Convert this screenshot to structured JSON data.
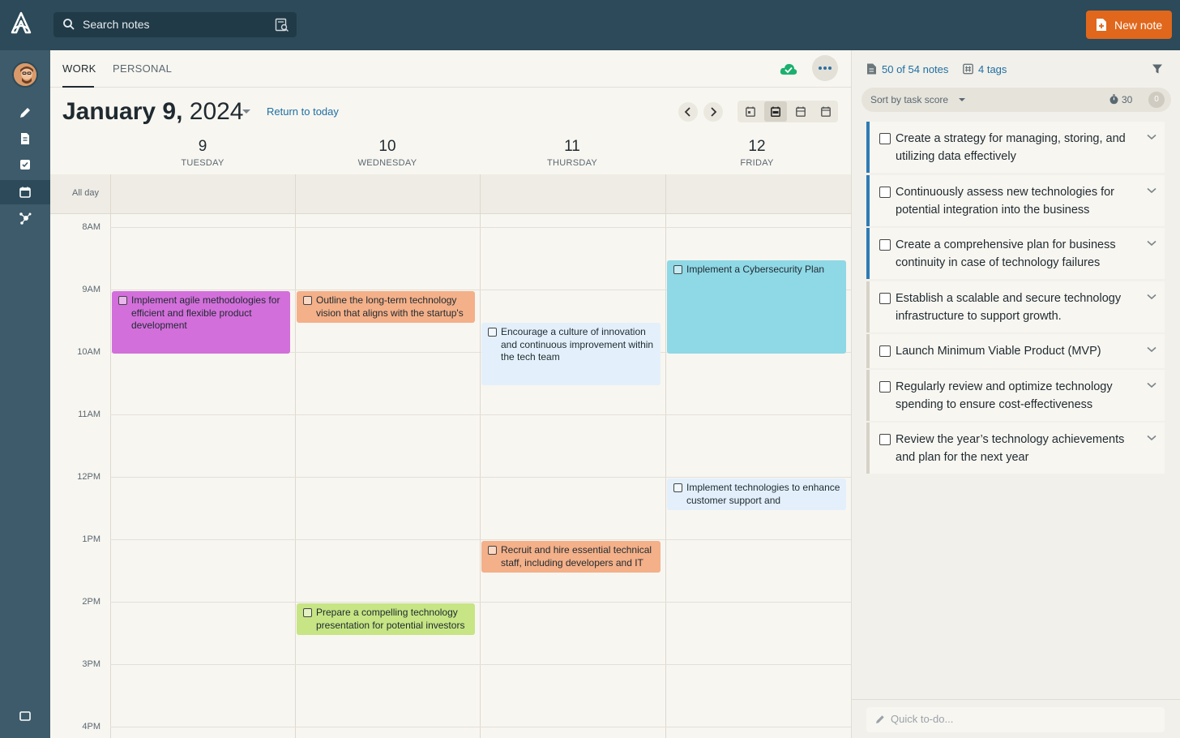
{
  "search": {
    "placeholder": "Search notes"
  },
  "new_note": {
    "label": "New note"
  },
  "tabs": [
    {
      "label": "WORK"
    },
    {
      "label": "PERSONAL"
    }
  ],
  "date": {
    "month_day": "January 9,",
    "year": " 2024"
  },
  "return_today": "Return to today",
  "days": [
    {
      "num": "9",
      "name": "TUESDAY"
    },
    {
      "num": "10",
      "name": "WEDNESDAY"
    },
    {
      "num": "11",
      "name": "THURSDAY"
    },
    {
      "num": "12",
      "name": "FRIDAY"
    }
  ],
  "allday_label": "All day",
  "time_labels": [
    "8AM",
    "9AM",
    "10AM",
    "11AM",
    "12PM",
    "1PM",
    "2PM",
    "3PM",
    "4PM"
  ],
  "events": [
    {
      "text": "Implement agile methodologies for efficient and flexible product development",
      "color": "#d36fdb"
    },
    {
      "text": "Outline the long-term technology vision that aligns with the startup's",
      "color": "#f4b089"
    },
    {
      "text": "Encourage a culture of innovation and continuous improvement within the tech team",
      "color": "#e3f0fb"
    },
    {
      "text": "Implement a Cybersecurity Plan",
      "color": "#8fd8e6"
    },
    {
      "text": "Implement technologies to enhance customer support and",
      "color": "#e3f0fb"
    },
    {
      "text": "Recruit and hire essential technical staff, including developers and IT",
      "color": "#f4b089"
    },
    {
      "text": "Prepare a compelling technology presentation for potential investors",
      "color": "#c7e584"
    }
  ],
  "right_panel": {
    "notes_count": "50 of 54 notes",
    "tags_count": "4 tags",
    "sort_label": "Sort by task score",
    "timer_value": "30",
    "badge": "0",
    "tasks": [
      "Create a strategy for managing, storing, and utilizing data effectively",
      "Continuously assess new technologies for potential integration into the business",
      "Create a comprehensive plan for business continuity in case of technology failures",
      "Establish a scalable and secure technology infrastructure to support growth.",
      "Launch Minimum Viable Product (MVP)",
      "Regularly review and optimize technology spending to ensure cost-effectiveness",
      "Review the year’s technology achievements and plan for the next year"
    ],
    "quick_placeholder": "Quick to-do..."
  },
  "colors": {
    "topbar": "#2c4a59",
    "rail": "#3d5b6a",
    "accent": "#e0671b",
    "link": "#1e6fa3"
  }
}
